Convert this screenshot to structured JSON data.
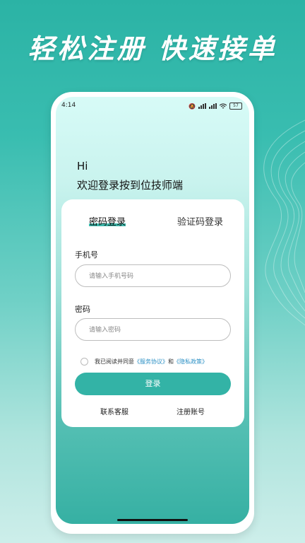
{
  "banner": {
    "title": "轻松注册  快速接单"
  },
  "status_bar": {
    "time": "4:14",
    "battery": "57"
  },
  "greeting": {
    "hi": "Hi",
    "welcome": "欢迎登录按到位技师端"
  },
  "tabs": [
    {
      "label": "密码登录",
      "active": true
    },
    {
      "label": "验证码登录",
      "active": false
    }
  ],
  "form": {
    "phone_label": "手机号",
    "phone_placeholder": "请输入手机号码",
    "password_label": "密码",
    "password_placeholder": "请输入密码"
  },
  "agreement": {
    "text": "我已阅读并同意",
    "service_link": "《服务协议》",
    "and": "和",
    "privacy_link": "《隐私政策》"
  },
  "login_button": "登录",
  "footer": {
    "contact": "联系客服",
    "register": "注册账号"
  },
  "colors": {
    "accent": "#33b3a6",
    "link": "#2a8fc4"
  }
}
